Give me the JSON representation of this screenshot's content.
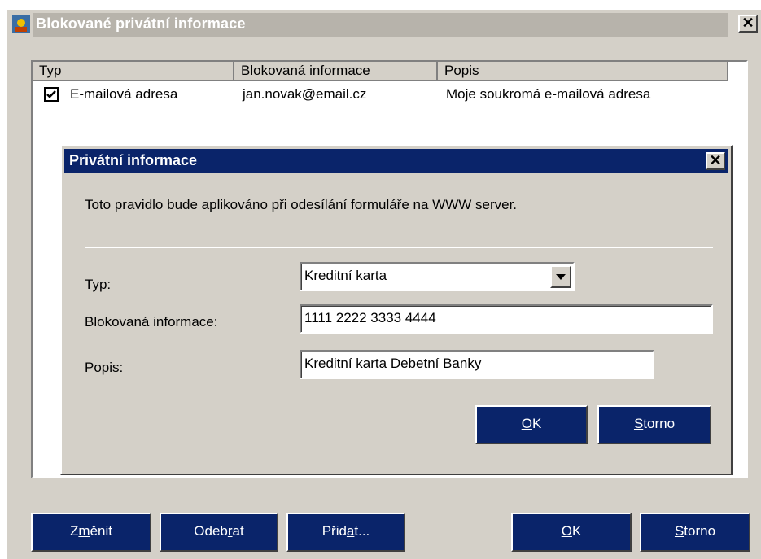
{
  "window": {
    "title": "Blokované privátní informace",
    "close_label": "✕"
  },
  "list": {
    "columns": [
      "Typ",
      "Blokovaná informace",
      "Popis"
    ],
    "rows": [
      {
        "checked": true,
        "typ": "E-mailová adresa",
        "info": "jan.novak@email.cz",
        "popis": "Moje soukromá e-mailová adresa"
      }
    ]
  },
  "dialog": {
    "title": "Privátní informace",
    "close_label": "✕",
    "message": "Toto pravidlo bude aplikováno při odesílání formuláře na WWW server.",
    "typ_label": "Typ:",
    "typ_value": "Kreditní karta",
    "info_label": "Blokovaná informace:",
    "info_value": "1111 2222 3333 4444",
    "popis_label": "Popis:",
    "popis_value": "Kreditní karta Debetní Banky",
    "ok_pre": "",
    "ok_u": "O",
    "ok_post": "K",
    "cancel_pre": "",
    "cancel_u": "S",
    "cancel_post": "torno"
  },
  "footer": {
    "change_pre": "Z",
    "change_u": "m",
    "change_post": "ěnit",
    "remove_pre": "Odeb",
    "remove_u": "r",
    "remove_post": "at",
    "add_pre": "Přid",
    "add_u": "a",
    "add_post": "t...",
    "ok_pre": "",
    "ok_u": "O",
    "ok_post": "K",
    "cancel_pre": "",
    "cancel_u": "S",
    "cancel_post": "torno"
  },
  "colors": {
    "accent": "#0a246a",
    "face": "#d4d0c8"
  }
}
